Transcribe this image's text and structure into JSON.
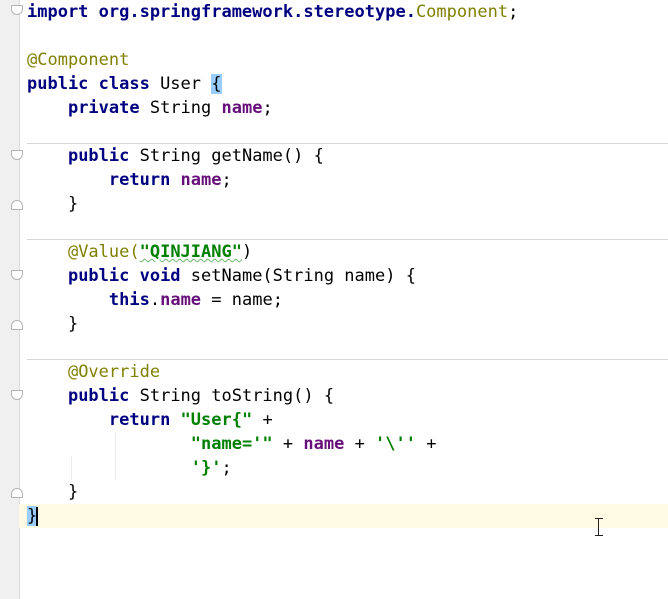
{
  "editor": {
    "language": "java",
    "lines": {
      "l1": [
        "import org.springframework.stereotype.",
        "Component",
        ";"
      ],
      "l3": "@Component",
      "l4": [
        "public class ",
        "User ",
        "{"
      ],
      "l5": [
        "private ",
        "String ",
        "name",
        ";"
      ],
      "l7": [
        "public ",
        "String getName() {"
      ],
      "l8": [
        "return ",
        "name",
        ";"
      ],
      "l9": "}",
      "l11": [
        "@Value(",
        "\"QINJIANG\"",
        ")"
      ],
      "l12": [
        "public void ",
        "setName(String name) {"
      ],
      "l13": [
        "this",
        ".",
        "name",
        " = name;"
      ],
      "l14": "}",
      "l16": "@Override",
      "l17": [
        "public ",
        "String toString() {"
      ],
      "l18": [
        "return ",
        "\"User{\"",
        " +"
      ],
      "l19": [
        "\"name='\"",
        " + ",
        "name",
        " + ",
        "'\\''",
        " +"
      ],
      "l20": [
        "'}'",
        ";"
      ],
      "l21": "}",
      "l22": "}"
    }
  },
  "colors": {
    "keyword": "#000080",
    "annotation": "#808000",
    "field": "#660e7a",
    "string": "#008000",
    "current_line": "#fffae3",
    "brace_match": "#99ccff"
  }
}
